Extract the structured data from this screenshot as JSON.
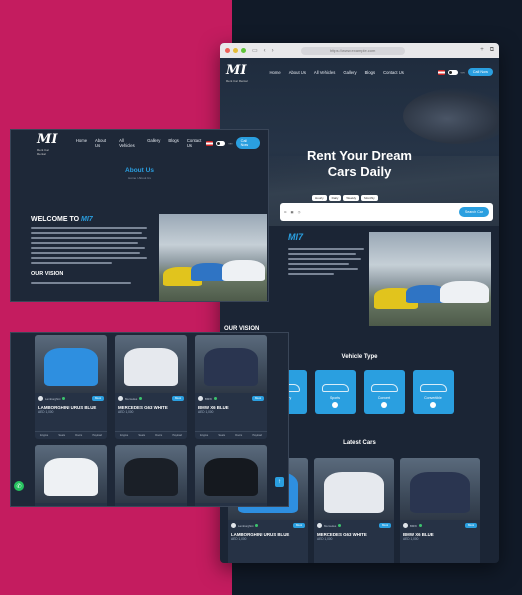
{
  "browser": {
    "url": "https://www.example.com"
  },
  "site": {
    "logo": "MI",
    "logo_sub": "Rent Car Rental",
    "nav": [
      "Home",
      "About Us",
      "All Vehicles",
      "Gallery",
      "Blogs",
      "Contact Us"
    ],
    "cta": "Call Now"
  },
  "hero": {
    "title_line1": "Rent Your Dream",
    "title_line2": "Cars Daily",
    "search_tabs": [
      "Hourly",
      "Daily",
      "Weekly",
      "Monthly"
    ],
    "search_button": "Search Car"
  },
  "about": {
    "title": "About Us",
    "breadcrumb": "Home / About Us",
    "welcome_prefix": "WELCOME TO",
    "brand": "MI7",
    "vision_heading": "OUR VISION"
  },
  "vehicle_types": {
    "heading": "Vehicle Type",
    "items": [
      "Luxury",
      "Sports",
      "Convert",
      "Convertible"
    ]
  },
  "latest": {
    "heading": "Latest Cars",
    "book_label": "Book",
    "brand_label": "Mercedes",
    "spec_labels": [
      "Engine",
      "Seats",
      "Doors",
      "Payload"
    ],
    "cards": [
      {
        "name": "LAMBORGHINI URUS BLUE",
        "price": "AED 1,000",
        "tag": "Lamborghini"
      },
      {
        "name": "MERCEDES G63 WHITE",
        "price": "AED 1,000",
        "tag": "Mercedes"
      },
      {
        "name": "BMW X6 BLUE",
        "price": "AED 1,000",
        "tag": "BMW"
      }
    ],
    "grid_cards": [
      {
        "name": "LAMBORGHINI URUS BLUE",
        "price": "AED 1,000",
        "tag": "Lamborghini",
        "color": "#2e8fe0"
      },
      {
        "name": "MERCEDES G63 WHITE",
        "price": "AED 1,000",
        "tag": "Mercedes",
        "color": "#e6e9ee"
      },
      {
        "name": "BMW X6 BLUE",
        "price": "AED 1,000",
        "tag": "BMW",
        "color": "#2a3550"
      },
      {
        "name": "",
        "price": "",
        "tag": "Mercedes",
        "color": "#eef1f4"
      },
      {
        "name": "",
        "price": "",
        "tag": "Mercedes",
        "color": "#1a1f27"
      },
      {
        "name": "",
        "price": "",
        "tag": "BMW",
        "color": "#15191f"
      }
    ]
  },
  "colors": {
    "accent": "#2a9fe0",
    "magenta": "#c41c5f",
    "navy": "#1b2535"
  }
}
